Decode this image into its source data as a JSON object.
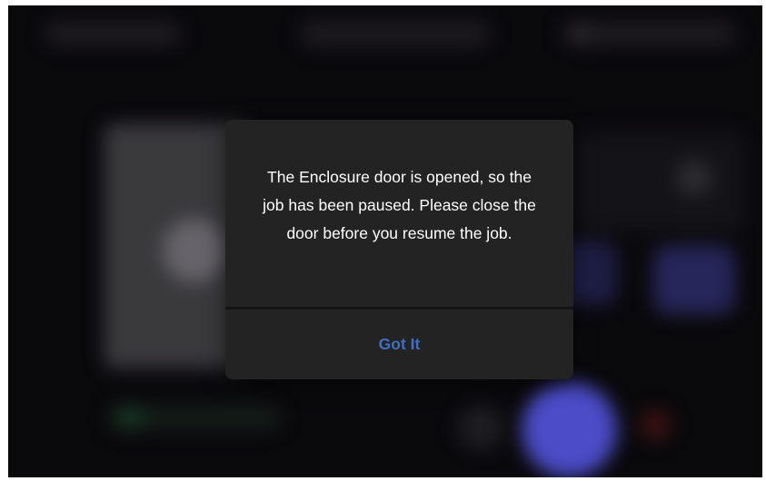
{
  "dialog": {
    "message": "The Enclosure door is opened, so the job has been paused. Please close the door before you resume the job.",
    "confirm_label": "Got It"
  },
  "colors": {
    "dialog_background": "#232323",
    "button_text": "#3f6fc4",
    "message_text": "#ffffff"
  }
}
